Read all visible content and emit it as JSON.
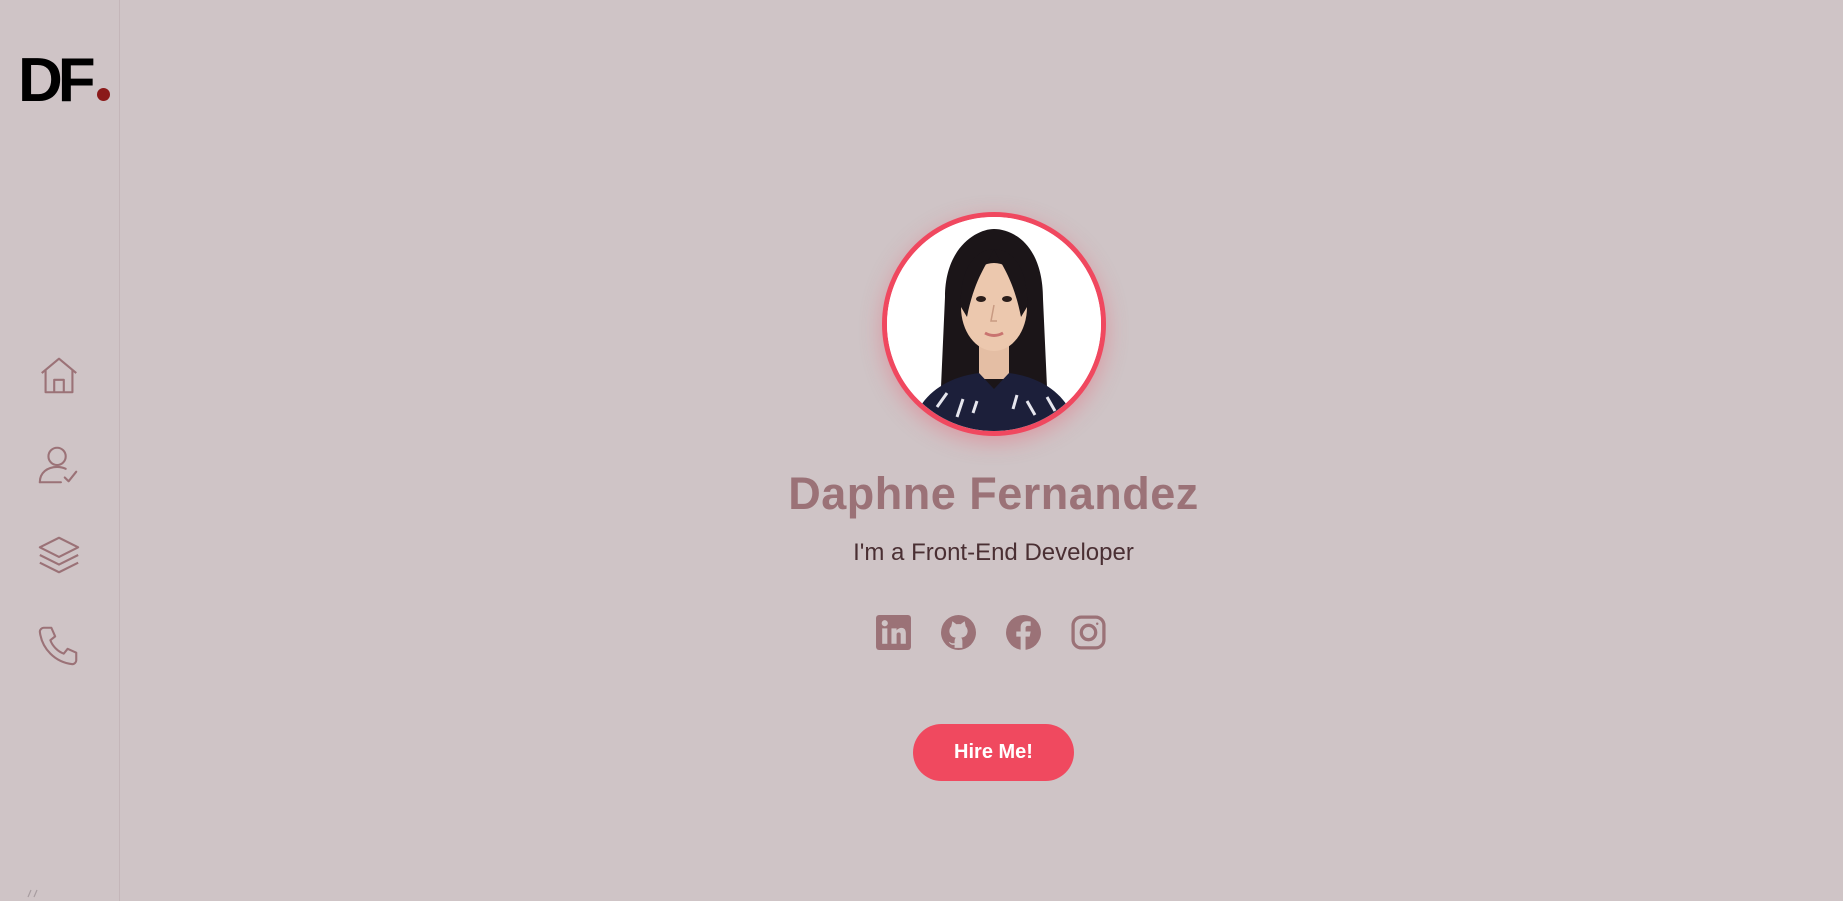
{
  "logo": {
    "text": "DF"
  },
  "sidebar": {
    "items": [
      {
        "icon": "home-icon",
        "label": "Home"
      },
      {
        "icon": "user-check-icon",
        "label": "About"
      },
      {
        "icon": "layers-icon",
        "label": "Portfolio"
      },
      {
        "icon": "phone-icon",
        "label": "Contact"
      }
    ]
  },
  "hero": {
    "name": "Daphne Fernandez",
    "tagline": "I'm a Front-End Developer",
    "button_label": "Hire Me!"
  },
  "socials": [
    {
      "icon": "linkedin-icon"
    },
    {
      "icon": "github-icon"
    },
    {
      "icon": "facebook-icon"
    },
    {
      "icon": "instagram-icon"
    }
  ],
  "colors": {
    "background": "#cfc4c6",
    "accent": "#f0485f",
    "icon": "#9b7277",
    "name": "#9b7277",
    "tagline": "#4a2f33",
    "logo_dot": "#8b1a1a"
  }
}
